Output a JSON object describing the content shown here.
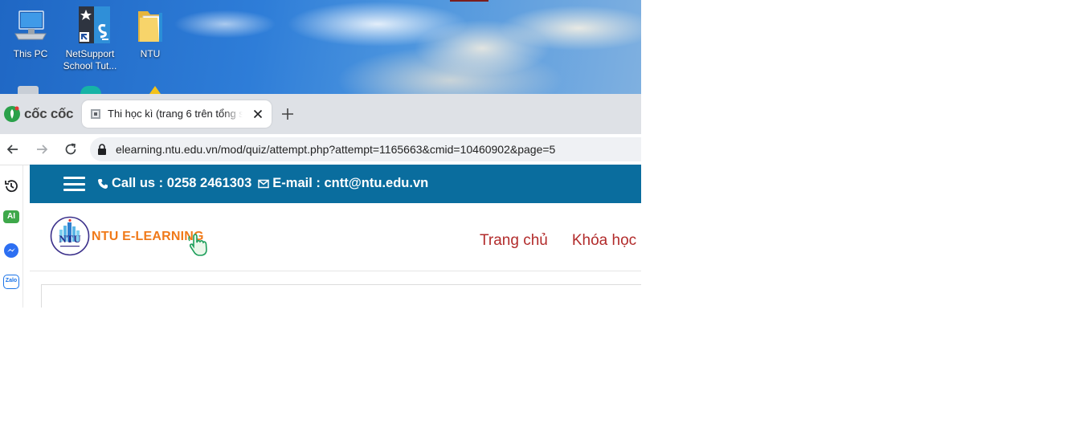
{
  "desktop": {
    "icons": [
      {
        "label": "This PC",
        "icon": "this-pc-icon"
      },
      {
        "label": "NetSupport School Tut...",
        "icon": "netsupport-icon"
      },
      {
        "label": "NTU",
        "icon": "folder-icon"
      }
    ]
  },
  "browser": {
    "brand": "cốc cốc",
    "tab": {
      "title": "Thi học kì (trang 6 trên tổng số"
    },
    "address_bar": {
      "url": "elearning.ntu.edu.vn/mod/quiz/attempt.php?attempt=1165663&cmid=10460902&page=5"
    },
    "side_panel": [
      "history-icon",
      "ai-icon",
      "messenger-icon",
      "zalo-icon"
    ],
    "side_labels": {
      "ai": "AI",
      "zalo": "Zalo"
    }
  },
  "page": {
    "topbar": {
      "phone_text": "Call us : 0258 2461303",
      "email_text": "E-mail : cntt@ntu.edu.vn"
    },
    "header": {
      "logo_text": "NTU",
      "brand": "NTU E-LEARNING",
      "nav": [
        "Trang chủ",
        "Khóa học"
      ]
    }
  },
  "colors": {
    "topbar": "#0a6d9e",
    "brand": "#f07a1a",
    "nav": "#b22b2b",
    "tabbar": "#dee1e6"
  }
}
